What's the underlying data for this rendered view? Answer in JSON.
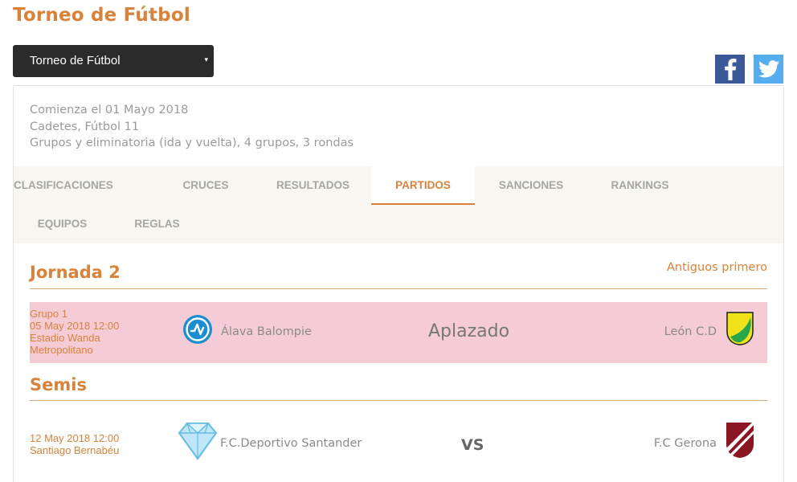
{
  "page": {
    "title": "Torneo de Fútbol"
  },
  "tournament_select": {
    "value": "Torneo de Fútbol",
    "caret": "▾"
  },
  "social": {
    "facebook_icon": "facebook-icon",
    "twitter_icon": "twitter-icon"
  },
  "info": {
    "line1": "Comienza el 01 Mayo 2018",
    "line2": "Cadetes, Fútbol 11",
    "line3": "Grupos y eliminatoria (ida y vuelta), 4 grupos, 3 rondas"
  },
  "tabs": [
    {
      "label": "CLASIFICACIONES"
    },
    {
      "label": "CRUCES"
    },
    {
      "label": "RESULTADOS"
    },
    {
      "label": "PARTIDOS",
      "active": true
    },
    {
      "label": "SANCIONES"
    },
    {
      "label": "RANKINGS"
    },
    {
      "label": "EQUIPOS"
    },
    {
      "label": "REGLAS"
    }
  ],
  "sort_link": "Antiguos primero",
  "sections": [
    {
      "title": "Jornada 2",
      "matches": [
        {
          "group": "Grupo 1",
          "datetime": "05 May 2018 12:00",
          "venue": "Estadio Wanda Metropolitano",
          "home": "Álava Balompie",
          "status": "Aplazado",
          "away": "León C.D"
        }
      ]
    },
    {
      "title": "Semis",
      "matches": [
        {
          "datetime": "12 May 2018 12:00",
          "venue": "Santiago Bernabéu",
          "home": "F.C.Deportivo Santander",
          "status": "VS",
          "away": "F.C Gerona"
        }
      ]
    }
  ],
  "colors": {
    "accent": "#d9823a",
    "postponed_bg": "#f5ccd5",
    "tabs_bg": "#f7f6f0",
    "facebook": "#3b5998",
    "twitter": "#55acee"
  }
}
